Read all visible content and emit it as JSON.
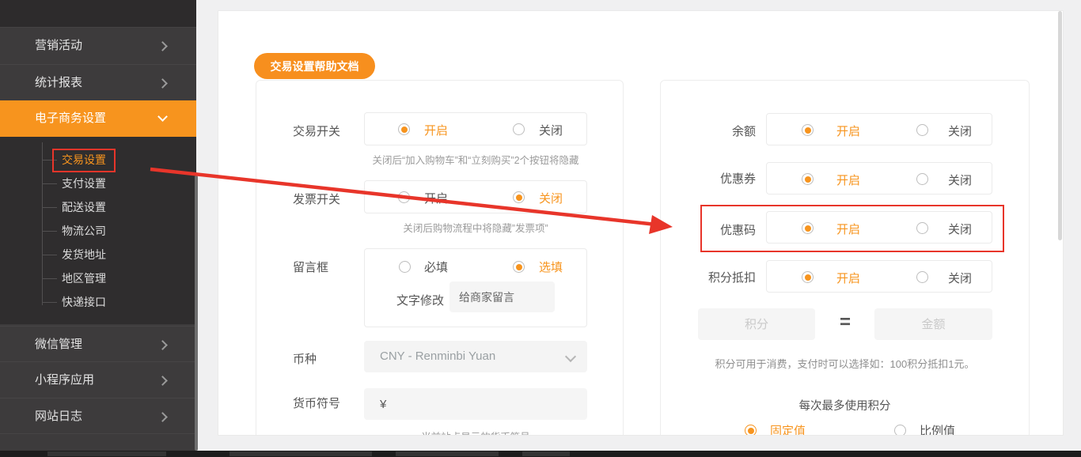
{
  "sidebar": {
    "top_items": [
      {
        "label": "营销活动"
      },
      {
        "label": "统计报表"
      },
      {
        "label": "电子商务设置"
      }
    ],
    "submenu": [
      {
        "label": "交易设置"
      },
      {
        "label": "支付设置"
      },
      {
        "label": "配送设置"
      },
      {
        "label": "物流公司"
      },
      {
        "label": "发货地址"
      },
      {
        "label": "地区管理"
      },
      {
        "label": "快递接口"
      }
    ],
    "bottom_items": [
      {
        "label": "微信管理"
      },
      {
        "label": "小程序应用"
      },
      {
        "label": "网站日志"
      }
    ]
  },
  "main": {
    "help_button": "交易设置帮助文档",
    "left_card": {
      "trade_switch": {
        "label": "交易开关",
        "on": "开启",
        "off": "关闭",
        "note": "关闭后“加入购物车”和“立刻购买”2个按钮将隐藏"
      },
      "invoice_switch": {
        "label": "发票开关",
        "on": "开启",
        "off": "关闭",
        "note": "关闭后购物流程中将隐藏”发票项”"
      },
      "message_box": {
        "label": "留言框",
        "required": "必填",
        "optional": "选填",
        "modify_label": "文字修改",
        "modify_value": "给商家留言"
      },
      "currency": {
        "label": "币种",
        "value": "CNY - Renminbi Yuan"
      },
      "currency_symbol": {
        "label": "货币符号",
        "value": "¥",
        "note": "当前站点显示的货币符号"
      }
    },
    "right_card": {
      "on_label": "开启",
      "off_label": "关闭",
      "balance_label": "余额",
      "coupon_label": "优惠券",
      "coupon_code_label": "优惠码",
      "points_deduct_label": "积分抵扣",
      "points_placeholder": "积分",
      "equals": "=",
      "amount_placeholder": "金额",
      "points_note": "积分可用于消费，支付时可以选择如：100积分抵扣1元。",
      "max_points_label": "每次最多使用积分",
      "fixed_label": "固定值",
      "ratio_label": "比例值"
    }
  },
  "colors": {
    "accent": "#f7941e",
    "annotation_red": "#e8352a"
  }
}
